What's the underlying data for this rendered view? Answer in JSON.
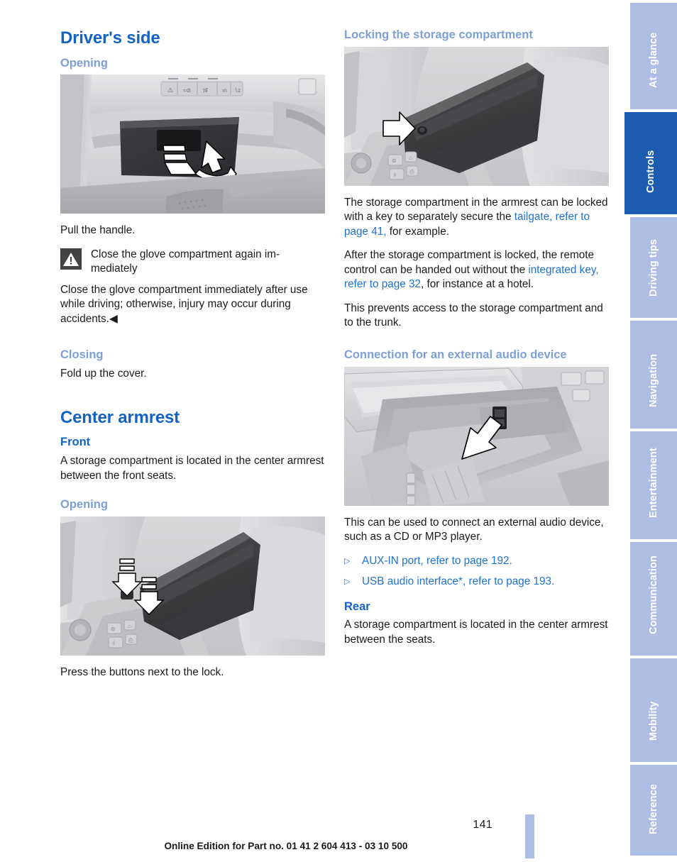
{
  "document": {
    "page_number": "141",
    "footer": "Online Edition for Part no. 01 41 2 604 413 - 03 10 500"
  },
  "colors": {
    "heading_dark_blue": "#1263c4",
    "heading_light_blue": "#7e9fd6",
    "link_blue": "#1d72d2",
    "tab_inactive": "#aebde4",
    "tab_active": "#1b5cb0",
    "note_icon_bg": "#434343"
  },
  "left_column": {
    "heading_drivers_side": "Driver's side",
    "heading_opening_1": "Opening",
    "figure_glove_compartment_caption": "",
    "text_pull_handle": "Pull the handle.",
    "warning": {
      "title": "Close the glove compartment again im-mediately",
      "title_display": "Close the glove compartment again im-",
      "title_line2": "mediately",
      "body": "Close the glove compartment immediately after use while driving; otherwise, injury may occur during accidents.◀"
    },
    "heading_closing": "Closing",
    "text_fold_up_cover": "Fold up the cover.",
    "heading_center_armrest": "Center armrest",
    "heading_front": "Front",
    "text_front_body": "A storage compartment is located in the center armrest between the front seats.",
    "heading_opening_2": "Opening",
    "text_press_buttons": "Press the buttons next to the lock."
  },
  "right_column": {
    "heading_locking": "Locking the storage compartment",
    "paragraph_locked_key": {
      "part1": "The storage compartment in the armrest can be locked with a key to separately secure the ",
      "link1": "tailgate, refer to page 41,",
      "part2": " for example."
    },
    "paragraph_remote": {
      "part1": "After the storage compartment is locked, the remote control can be handed out without the ",
      "link1": "integrated key, refer to page 32",
      "part2": ", for instance at a hotel."
    },
    "paragraph_prevents": "This prevents access to the storage compartment and to the trunk.",
    "heading_connection": "Connection for an external audio device",
    "text_external_audio": "This can be used to connect an external audio device, such as a CD or MP3 player.",
    "bullets": [
      {
        "marker": "▷",
        "text": "AUX-IN port, refer to page 192."
      },
      {
        "marker": "▷",
        "text": "USB audio interface*, refer to page 193."
      }
    ],
    "heading_rear": "Rear",
    "text_rear_body": "A storage compartment is located in the center armrest between the seats."
  },
  "sidebar": {
    "tabs": [
      {
        "label": "At a glance",
        "active": false
      },
      {
        "label": "Controls",
        "active": true
      },
      {
        "label": "Driving tips",
        "active": false
      },
      {
        "label": "Navigation",
        "active": false
      },
      {
        "label": "Entertainment",
        "active": false
      },
      {
        "label": "Communication",
        "active": false
      },
      {
        "label": "Mobility",
        "active": false
      },
      {
        "label": "Reference",
        "active": false
      }
    ]
  },
  "figures": {
    "glove_compartment": "glove-compartment-handle-photo",
    "armrest_locked": "center-armrest-lock-photo",
    "armrest_buttons": "center-armrest-buttons-photo",
    "aux_port": "aux-usb-port-photo"
  }
}
